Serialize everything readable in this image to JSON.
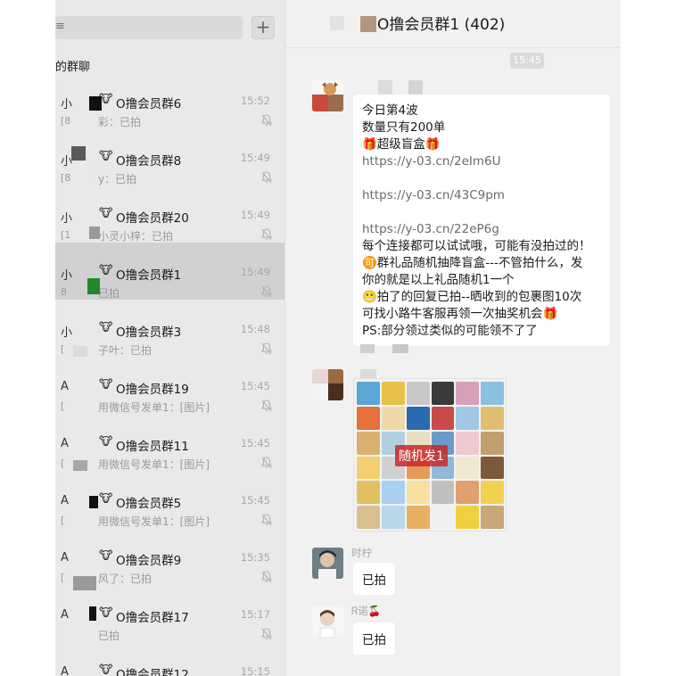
{
  "left_panel": {
    "search_fragment": "≡",
    "add_button": "+",
    "section_title": "的群聊",
    "chats": [
      {
        "prefix": "小",
        "prefix2": "[8",
        "name": "O撸会员群6",
        "time": "15:52",
        "preview": "彩：已拍",
        "selected": false
      },
      {
        "prefix": "小",
        "prefix2": "[8",
        "name": "O撸会员群8",
        "time": "15:49",
        "preview": "y：已拍",
        "selected": false
      },
      {
        "prefix": "小",
        "prefix2": "[1",
        "name": "O撸会员群20",
        "time": "15:49",
        "preview": "小灵小梓：已拍",
        "selected": false
      },
      {
        "prefix": "小",
        "prefix2": "8",
        "name": "O撸会员群1",
        "time": "15:49",
        "preview": "已拍",
        "selected": true
      },
      {
        "prefix": "小",
        "prefix2": "[",
        "name": "O撸会员群3",
        "time": "15:48",
        "preview": "子叶：已拍",
        "selected": false
      },
      {
        "prefix": "A",
        "prefix2": "[",
        "name": "O撸会员群19",
        "time": "15:45",
        "preview": "用微信号发单1：[图片]",
        "selected": false
      },
      {
        "prefix": "A",
        "prefix2": "[",
        "name": "O撸会员群11",
        "time": "15:45",
        "preview": "用微信号发单1：[图片]",
        "selected": false
      },
      {
        "prefix": "A",
        "prefix2": "[",
        "name": "O撸会员群5",
        "time": "15:45",
        "preview": "用微信号发单1：[图片]",
        "selected": false
      },
      {
        "prefix": "A",
        "prefix2": "[",
        "name": "O撸会员群9",
        "time": "15:35",
        "preview": "风了：已拍",
        "selected": false
      },
      {
        "prefix": "A",
        "prefix2": "",
        "name": "O撸会员群17",
        "time": "15:17",
        "preview": "已拍",
        "selected": false
      },
      {
        "prefix": "A",
        "prefix2": "",
        "name": "O撸会员群12",
        "time": "15:15",
        "preview": "",
        "selected": false
      }
    ]
  },
  "chat": {
    "title": "O撸会员群1 (402)",
    "time_divider": "15:45",
    "message1_lines": [
      {
        "text": "今日第4波",
        "link": false
      },
      {
        "text": "数量只有200单",
        "link": false
      },
      {
        "text": "🎁超级盲盒🎁",
        "link": false
      },
      {
        "text": "https://y-03.cn/2eIm6U",
        "link": true
      },
      {
        "text": "",
        "link": false
      },
      {
        "text": "https://y-03.cn/43C9pm",
        "link": true
      },
      {
        "text": "",
        "link": false
      },
      {
        "text": "https://y-03.cn/22eP6g",
        "link": true
      },
      {
        "text": " 每个连接都可以试试哦，可能有没拍过的！",
        "link": false
      },
      {
        "text": "🉑群礼品随机抽降盲盒---不管拍什么，发",
        "link": false
      },
      {
        "text": "你的就是以上礼品随机1一个",
        "link": false
      },
      {
        "text": "😬拍了的回复已拍--晒收到的包裹图10次",
        "link": false
      },
      {
        "text": "可找小路牛客服再领一次抽奖机会🎁",
        "link": false
      },
      {
        "text": "PS:部分领过类似的可能领不了了",
        "link": false
      }
    ],
    "photo_caption": "随机发1",
    "message3": {
      "sender": "时柠",
      "text": "已拍"
    },
    "message4": {
      "sender": "Ꮢ诺🍒",
      "text": "已拍"
    }
  },
  "colors": {
    "list_bg": "#e9e9e9",
    "selected_bg": "#d1d1d1",
    "chat_bg": "#f1f1f1",
    "bubble_bg": "#ffffff"
  },
  "icons": {
    "cow": "cow-icon",
    "mute": "mute-bell-icon",
    "add": "plus-icon"
  }
}
